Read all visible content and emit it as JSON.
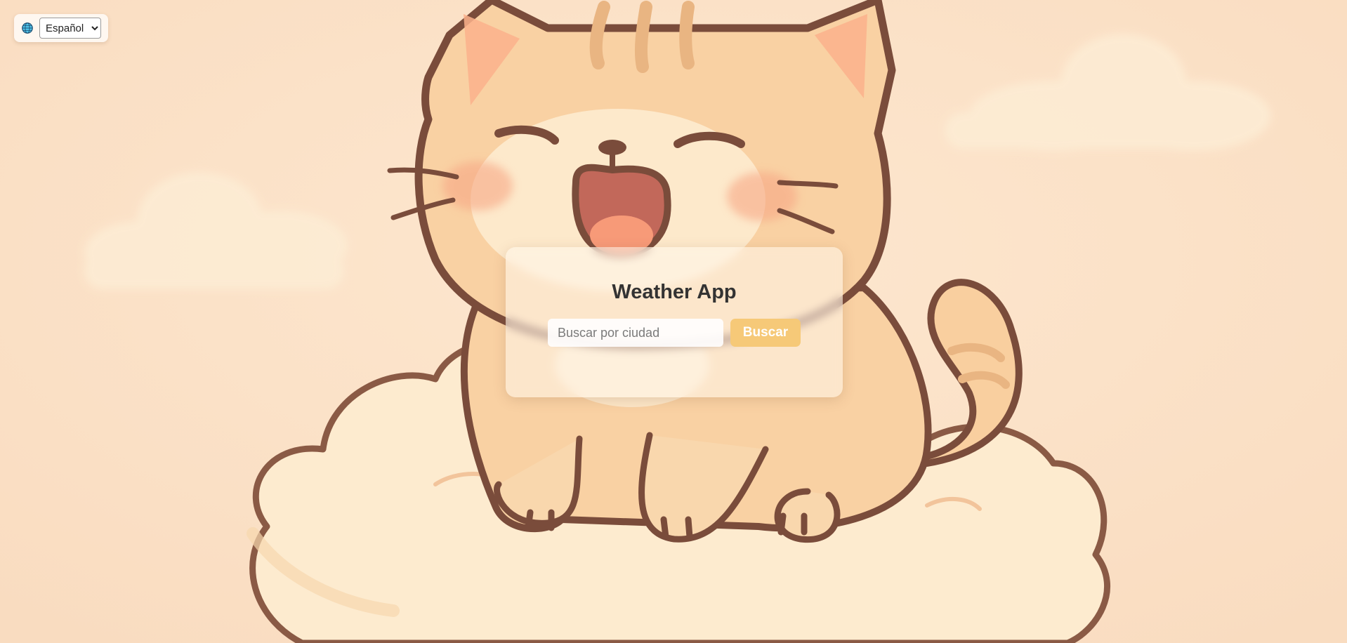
{
  "language": {
    "globe_icon": "globe-icon",
    "selected": "Español",
    "options": [
      "Español"
    ]
  },
  "app": {
    "title": "Weather App",
    "search_placeholder": "Buscar por ciudad",
    "search_value": "",
    "search_button": "Buscar"
  },
  "colors": {
    "background": "#fbe2c9",
    "button": "#f6c978",
    "title": "#333333"
  }
}
